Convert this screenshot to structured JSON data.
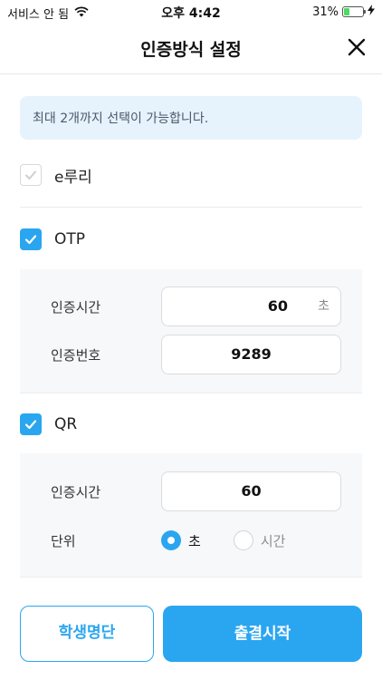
{
  "status_bar": {
    "carrier": "서비스 안 됨",
    "wifi_icon": "wifi-icon",
    "time": "오후 4:42",
    "battery_percent": "31%",
    "battery_level": 0.31,
    "charging_icon": "bolt-icon"
  },
  "header": {
    "title": "인증방식 설정",
    "close_icon": "close-icon"
  },
  "info": {
    "text": "최대 2개까지 선택이 가능합니다."
  },
  "methods": {
    "eruri": {
      "label": "e루리",
      "checked": true,
      "disabled": true
    },
    "otp": {
      "label": "OTP",
      "checked": true,
      "time_label": "인증시간",
      "time_value": "60",
      "time_unit": "초",
      "code_label": "인증번호",
      "code_value": "9289"
    },
    "qr": {
      "label": "QR",
      "checked": true,
      "time_label": "인증시간",
      "time_value": "60",
      "unit_label": "단위",
      "unit_options": [
        "초",
        "시간"
      ],
      "unit_selected": "초"
    }
  },
  "buttons": {
    "student_list": "학생명단",
    "start_attendance": "출결시작"
  },
  "colors": {
    "accent": "#2aa6f0",
    "info_bg": "#e6f3fd",
    "panel_bg": "#f7f8f9"
  }
}
